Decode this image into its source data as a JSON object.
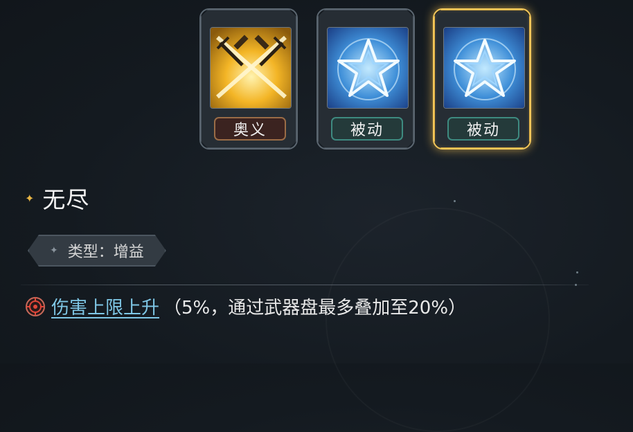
{
  "skill_cards": [
    {
      "icon": "crossed-swords-icon",
      "tag": "奥义",
      "tag_type": "ultimate",
      "selected": false
    },
    {
      "icon": "blue-star-icon",
      "tag": "被动",
      "tag_type": "passive",
      "selected": false
    },
    {
      "icon": "blue-star-icon",
      "tag": "被动",
      "tag_type": "passive",
      "selected": true
    }
  ],
  "skill": {
    "name": "无尽",
    "type_label": "类型：增益"
  },
  "effect": {
    "icon": "target-icon",
    "link_text": "伤害上限上升",
    "note": "（5%，通过武器盘最多叠加至20%）"
  },
  "colors": {
    "gold_accent": "#e7b444",
    "link_blue": "#7fc7e6",
    "passive_tag_bg": "#243a3a",
    "ultimate_tag_bg": "#3b2320"
  }
}
